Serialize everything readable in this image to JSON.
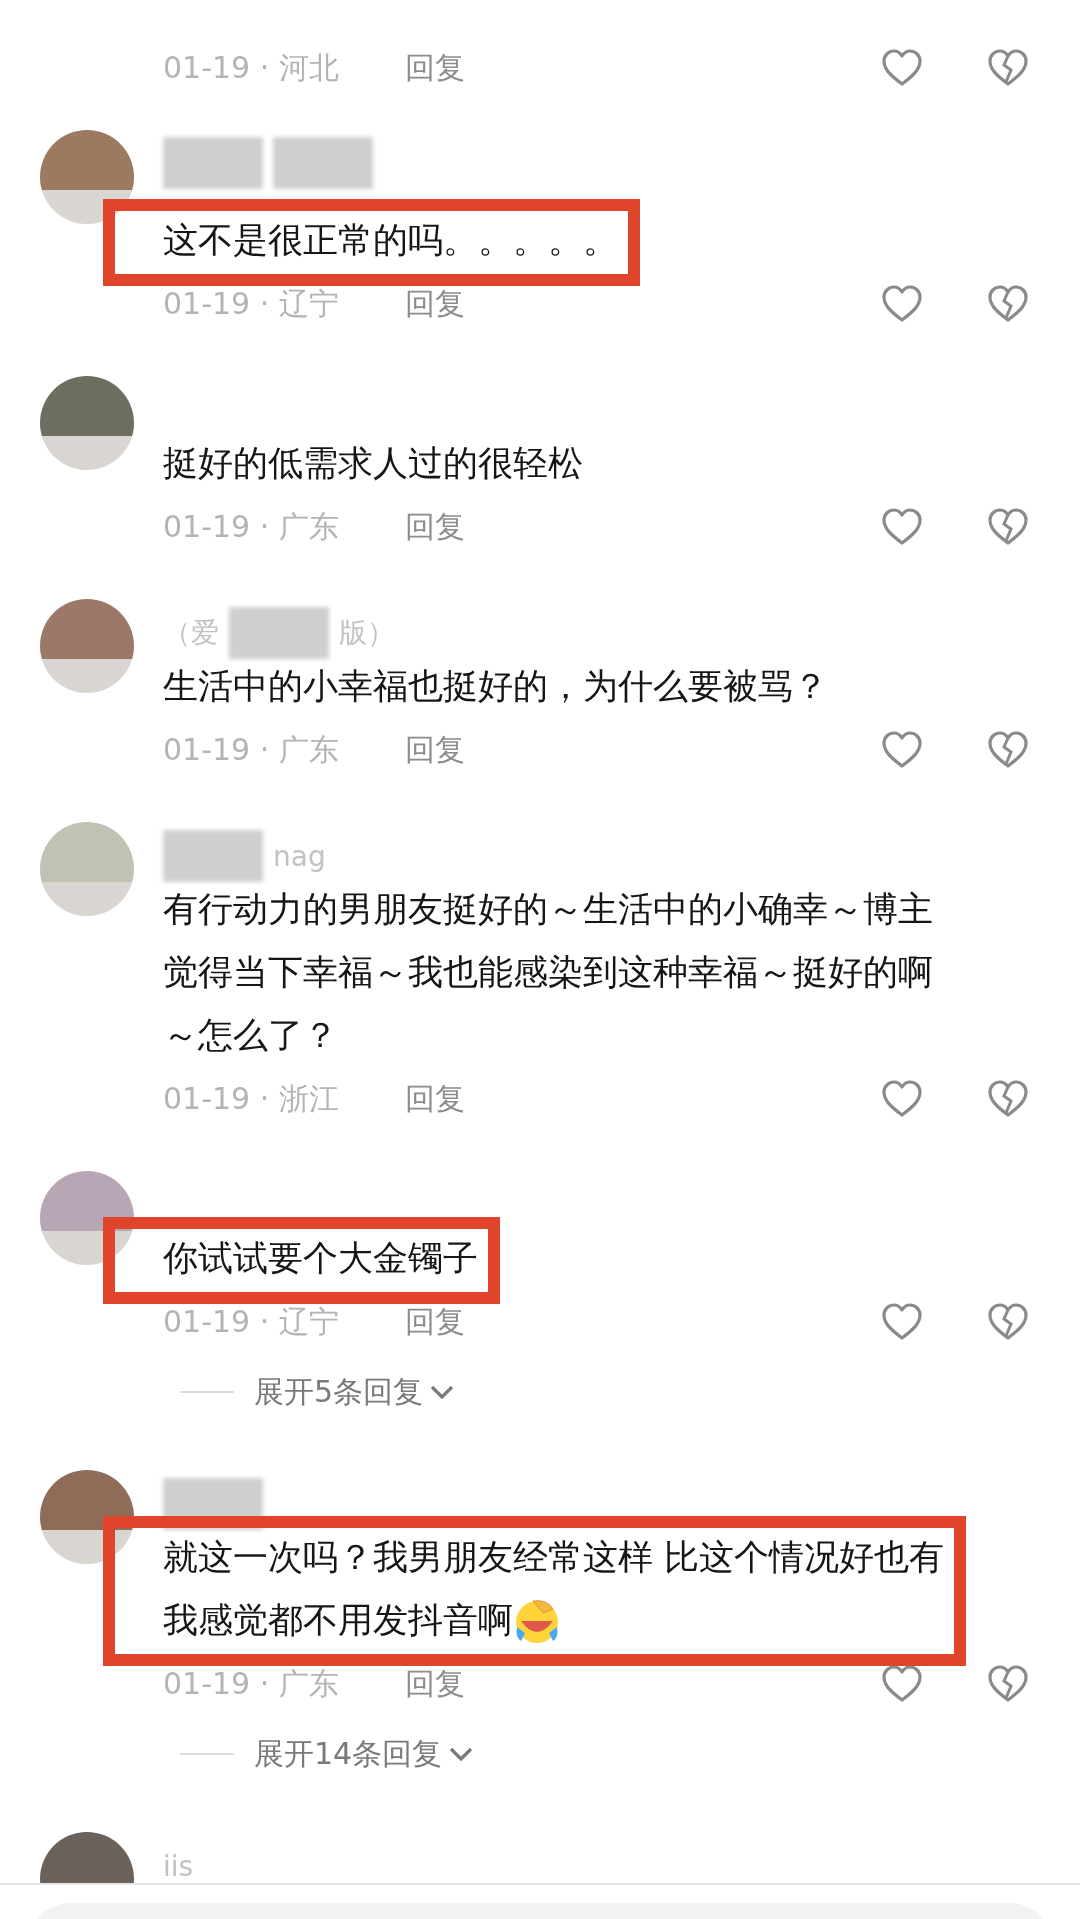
{
  "top_meta": {
    "date": "01-19 · 河北",
    "reply": "回复"
  },
  "comments": [
    {
      "name_parts": [
        {
          "kind": "blur"
        },
        {
          "kind": "blur"
        }
      ],
      "lines": [
        "这不是很正常的吗。。。。。"
      ],
      "highlighted": true,
      "date": "01-19 · 辽宁",
      "reply": "回复"
    },
    {
      "lines": [
        "挺好的低需求人过的很轻松"
      ],
      "date": "01-19 · 广东",
      "reply": "回复"
    },
    {
      "name_parts": [
        {
          "kind": "text",
          "text": "（爱"
        },
        {
          "kind": "blur"
        },
        {
          "kind": "text",
          "text": "版）"
        }
      ],
      "lines": [
        "生活中的小幸福也挺好的，为什么要被骂？"
      ],
      "date": "01-19 · 广东",
      "reply": "回复"
    },
    {
      "name_parts": [
        {
          "kind": "blur"
        },
        {
          "kind": "text",
          "text": "nag"
        }
      ],
      "lines": [
        "有行动力的男朋友挺好的～生活中的小确幸～博主",
        "觉得当下幸福～我也能感染到这种幸福～挺好的啊",
        "～怎么了？"
      ],
      "date": "01-19 · 浙江",
      "reply": "回复"
    },
    {
      "lines": [
        "你试试要个大金镯子"
      ],
      "highlighted": true,
      "date": "01-19 · 辽宁",
      "reply": "回复",
      "expand": "展开5条回复"
    },
    {
      "name_parts": [
        {
          "kind": "blur"
        }
      ],
      "lines": [
        "就这一次吗？我男朋友经常这样 比这个情况好也有",
        "我感觉都不用发抖音啊"
      ],
      "emoji": true,
      "highlighted": true,
      "date": "01-19 · 广东",
      "reply": "回复",
      "expand": "展开14条回复"
    },
    {
      "name_parts": [
        {
          "kind": "text",
          "text": "iis"
        }
      ]
    }
  ]
}
